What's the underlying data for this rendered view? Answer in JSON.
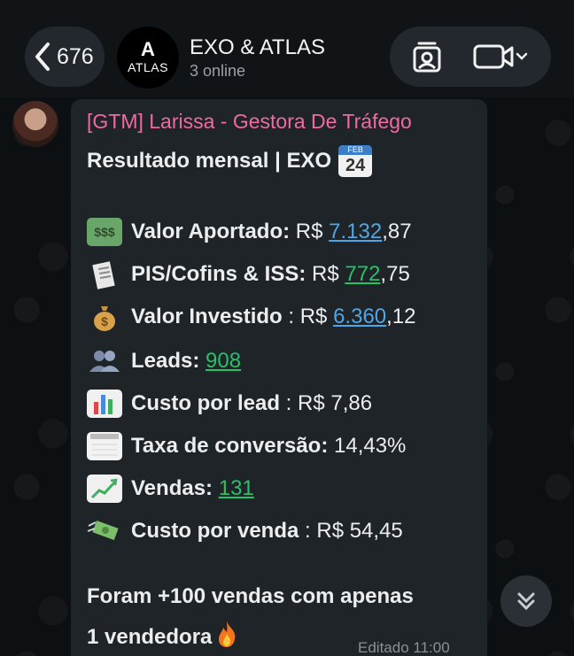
{
  "header": {
    "back_count": "676",
    "avatar_letter": "A",
    "avatar_text": "ATLAS",
    "title": "EXO & ATLAS",
    "subtitle": "3 online"
  },
  "message": {
    "sender": "[GTM] Larissa - Gestora De Tráfego",
    "headline": "Resultado mensal | EXO",
    "calendar_emoji_label": "FEB",
    "calendar_emoji_day": "24",
    "rows": [
      {
        "icon": "money-bill-icon",
        "label": "Valor Aportado:",
        "prefix": " R$ ",
        "link": "7.132",
        "suffix": ",87"
      },
      {
        "icon": "receipt-icon",
        "label": "PIS/Cofins & ISS:",
        "prefix": " R$ ",
        "link": "772",
        "suffix": ",75"
      },
      {
        "icon": "money-bag-icon",
        "label": "Valor Investido",
        "prefix": " : R$ ",
        "link": "6.360",
        "suffix": ",12"
      },
      {
        "icon": "people-icon",
        "label": "Leads:",
        "prefix": " ",
        "link": "908",
        "suffix": ""
      },
      {
        "icon": "bar-chart-icon",
        "label": "Custo por lead",
        "prefix": " : R$ 7,86",
        "link": "",
        "suffix": ""
      },
      {
        "icon": "calendar-icon",
        "label": "Taxa de conversão:",
        "prefix": " 14,43%",
        "link": "",
        "suffix": ""
      },
      {
        "icon": "trend-up-icon",
        "label": "Vendas:",
        "prefix": " ",
        "link": "131",
        "suffix": ""
      },
      {
        "icon": "flying-money-icon",
        "label": "Custo por venda",
        "prefix": " : R$ 54,45",
        "link": "",
        "suffix": ""
      }
    ],
    "closing_line1": "Foram +100 vendas com apenas",
    "closing_line2": "1 vendedora",
    "edited_time": "Editado 11:00"
  },
  "colors": {
    "sender": "#f06aa3",
    "link_blue": "#4fa6e8",
    "link_green": "#27c168",
    "bubble": "#1e2428"
  }
}
